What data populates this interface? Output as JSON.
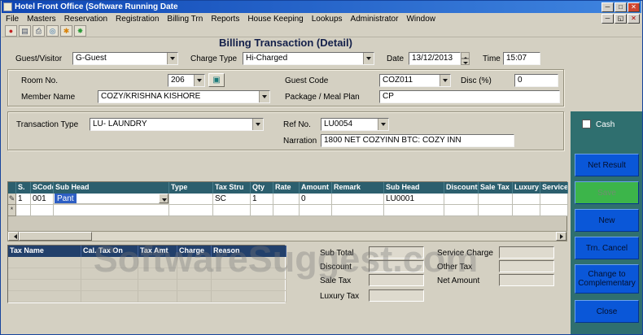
{
  "window": {
    "title": "Hotel Front Office (Software Running Date",
    "minimize": "─",
    "maximize": "□",
    "close": "✕"
  },
  "menu": {
    "items": [
      "File",
      "Masters",
      "Reservation",
      "Registration",
      "Billing Trn",
      "Reports",
      "House Keeping",
      "Lookups",
      "Administrator",
      "Window"
    ],
    "mdi_minimize": "─",
    "mdi_restore": "◱",
    "mdi_close": "✕"
  },
  "toolbar": {
    "icons": [
      {
        "name": "record-icon",
        "glyph": "●"
      },
      {
        "name": "new-icon",
        "glyph": "▤"
      },
      {
        "name": "print-icon",
        "glyph": "⎙"
      },
      {
        "name": "preview-icon",
        "glyph": "◎"
      },
      {
        "name": "settings-icon",
        "glyph": "✱"
      },
      {
        "name": "tools-icon",
        "glyph": "✸"
      }
    ]
  },
  "form": {
    "title": "Billing Transaction (Detail)",
    "guest_visitor": {
      "label": "Guest/Visitor",
      "value": "G-Guest"
    },
    "charge_type": {
      "label": "Charge Type",
      "value": "Hi-Charged"
    },
    "date": {
      "label": "Date",
      "value": "13/12/2013"
    },
    "time": {
      "label": "Time",
      "value": "15:07"
    },
    "room_no": {
      "label": "Room No.",
      "value": "206",
      "lookup_glyph": "▣"
    },
    "guest_code": {
      "label": "Guest Code",
      "value": "COZ011"
    },
    "disc": {
      "label": "Disc (%)",
      "value": "0"
    },
    "member_name": {
      "label": "Member Name",
      "value": "COZY/KRISHNA KISHORE"
    },
    "package": {
      "label": "Package / Meal Plan",
      "value": "CP"
    },
    "transaction_type": {
      "label": "Transaction Type",
      "value": "LU- LAUNDRY"
    },
    "ref_no": {
      "label": "Ref No.",
      "value": "LU0054"
    },
    "narration": {
      "label": "Narration",
      "value": "1800 NET COZYINN BTC: COZY INN"
    },
    "cash_label": "Cash"
  },
  "side_buttons": [
    {
      "label": "Net Result"
    },
    {
      "label": "Save"
    },
    {
      "label": "New"
    },
    {
      "label": "Trn. Cancel"
    },
    {
      "label": "Change to Complementary"
    },
    {
      "label": "Close"
    }
  ],
  "grid": {
    "columns": [
      "S.",
      "SCode",
      "Sub Head",
      "Type",
      "Tax Stru",
      "Qty",
      "Rate",
      "Amount",
      "Remark",
      "Sub Head",
      "Discount",
      "Sale Tax",
      "Luxury",
      "Service"
    ],
    "rows": [
      {
        "selector": "✎",
        "cells": [
          "1",
          "001",
          "Pant",
          "",
          "SC",
          "1",
          "",
          "0",
          "",
          "LU0001",
          "",
          "",
          "",
          ""
        ]
      },
      {
        "selector": "*",
        "cells": [
          "",
          "",
          "",
          "",
          "",
          "",
          "",
          "",
          "",
          "",
          "",
          "",
          "",
          ""
        ]
      }
    ]
  },
  "tax_grid": {
    "columns": [
      "Tax Name",
      "Cal. Tax On",
      "Tax Amt",
      "Charge",
      "Reason"
    ]
  },
  "totals": {
    "sub_total": "Sub Total",
    "discount": "Discount",
    "sale_tax": "Sale Tax",
    "luxury_tax": "Luxury Tax",
    "service_charge": "Service Charge",
    "other_tax": "Other Tax",
    "net_amount": "Net Amount"
  },
  "watermark": "SoftwareSuggest.com"
}
